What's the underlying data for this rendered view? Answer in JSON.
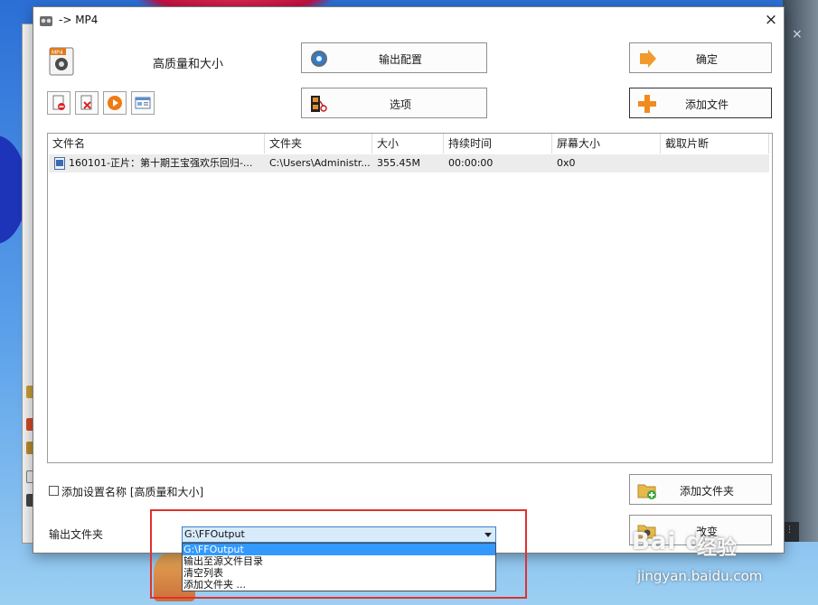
{
  "window": {
    "title": "-> MP4"
  },
  "profile": {
    "label": "高质量和大小"
  },
  "buttons": {
    "output_config": "输出配置",
    "ok": "确定",
    "options": "选项",
    "add_file": "添加文件",
    "add_folder": "添加文件夹",
    "change": "改变"
  },
  "table": {
    "headers": [
      "文件名",
      "文件夹",
      "大小",
      "持续时间",
      "屏幕大小",
      "截取片断"
    ],
    "rows": [
      {
        "name": "160101-正片：第十期王宝强欢乐回归-...",
        "folder": "C:\\Users\\Administr...",
        "size": "355.45M",
        "duration": "00:00:00",
        "screen": "0x0",
        "clip": ""
      }
    ]
  },
  "settings": {
    "checkbox_label": "添加设置名称 [高质量和大小]",
    "checkbox_checked": false
  },
  "output": {
    "label": "输出文件夹",
    "selected": "G:\\FFOutput",
    "options": [
      "G:\\FFOutput",
      "输出至源文件目录",
      "清空列表",
      "添加文件夹 ..."
    ]
  },
  "watermark": {
    "logo": "Bai du",
    "text": "经验",
    "url": "jingyan.baidu.com"
  },
  "colors": {
    "highlight": "#e23030",
    "selection": "#3399ff",
    "select_bg": "#d8ebfb"
  }
}
